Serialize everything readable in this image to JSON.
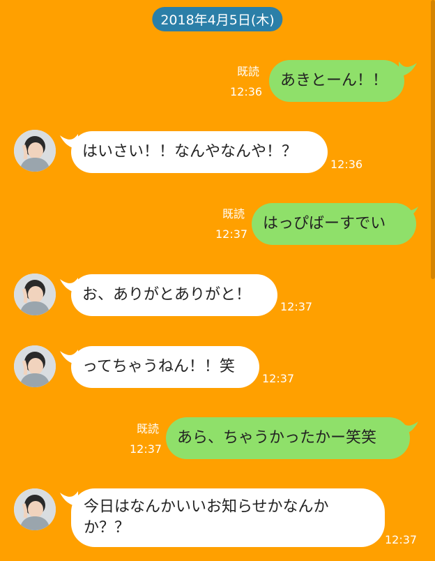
{
  "colors": {
    "background": "#FFA000",
    "outgoing_bubble": "#8FE06A",
    "incoming_bubble": "#FFFFFF",
    "date_pill": "#2B7FA8",
    "meta_text": "#FFFFFF"
  },
  "date_label": "2018年4月5日(木)",
  "messages": [
    {
      "direction": "out",
      "text": "あきとーん！！",
      "read": "既読",
      "time": "12:36"
    },
    {
      "direction": "in",
      "text": "はいさい！！なんやなんや！？",
      "time": "12:36"
    },
    {
      "direction": "out",
      "text": "はっぴばーすでい",
      "read": "既読",
      "time": "12:37"
    },
    {
      "direction": "in",
      "text": "お、ありがとありがと！",
      "time": "12:37"
    },
    {
      "direction": "in",
      "text": "ってちゃうねん！！笑",
      "time": "12:37"
    },
    {
      "direction": "out",
      "text": "あら、ちゃうかったかー笑笑",
      "read": "既読",
      "time": "12:37"
    },
    {
      "direction": "in",
      "text": "今日はなんかいいお知らせかなんかか？？",
      "time": "12:37"
    }
  ]
}
